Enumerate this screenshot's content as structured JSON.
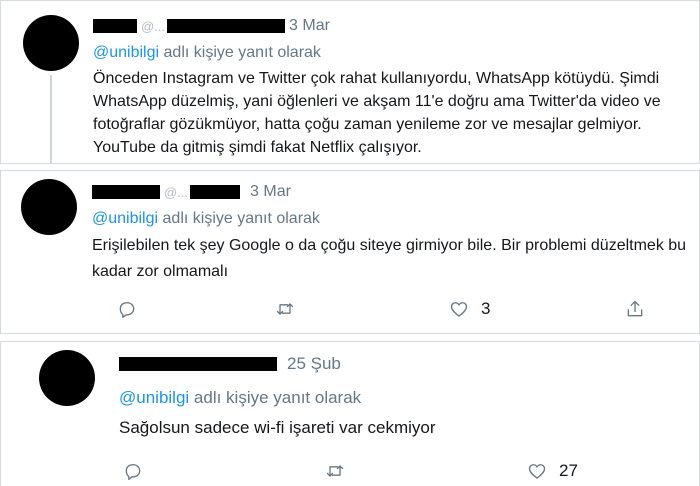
{
  "tweets": [
    {
      "name_hidden": "",
      "handle_hint": "@...",
      "date": "3 Mar",
      "replying_mention": "@unibilgi",
      "replying_suffix": "adlı kişiye yanıt olarak",
      "text": "Önceden Instagram ve Twitter çok rahat kullanıyordu, WhatsApp kötüydü. Şimdi WhatsApp düzelmiş, yani öğlenleri ve akşam 11'e doğru ama Twitter'da video ve fotoğraflar gözükmüyor, hatta çoğu zaman yenileme zor ve mesajlar gelmiyor. YouTube da gitmiş şimdi fakat Netflix çalışıyor."
    },
    {
      "handle_hint": "@...",
      "date": "3 Mar",
      "replying_mention": "@unibilgi",
      "replying_suffix": "adlı kişiye yanıt olarak",
      "text": "Erişilebilen tek şey Google o da çoğu siteye girmiyor bile. Bir problemi düzeltmek bu kadar zor olmamalı",
      "like_count": "3"
    },
    {
      "date": "25 Şub",
      "replying_mention": "@unibilgi",
      "replying_suffix": "adlı kişiye yanıt olarak",
      "text": "Sağolsun sadece wi-fi işareti var cekmiyor",
      "like_count": "27"
    }
  ],
  "icons": {
    "reply": "reply-icon",
    "retweet": "retweet-icon",
    "like": "heart-icon",
    "share": "share-icon"
  },
  "colors": {
    "mention": "#1b95e0",
    "muted": "#657786",
    "text": "#14171a",
    "border": "#d6dbe0"
  }
}
